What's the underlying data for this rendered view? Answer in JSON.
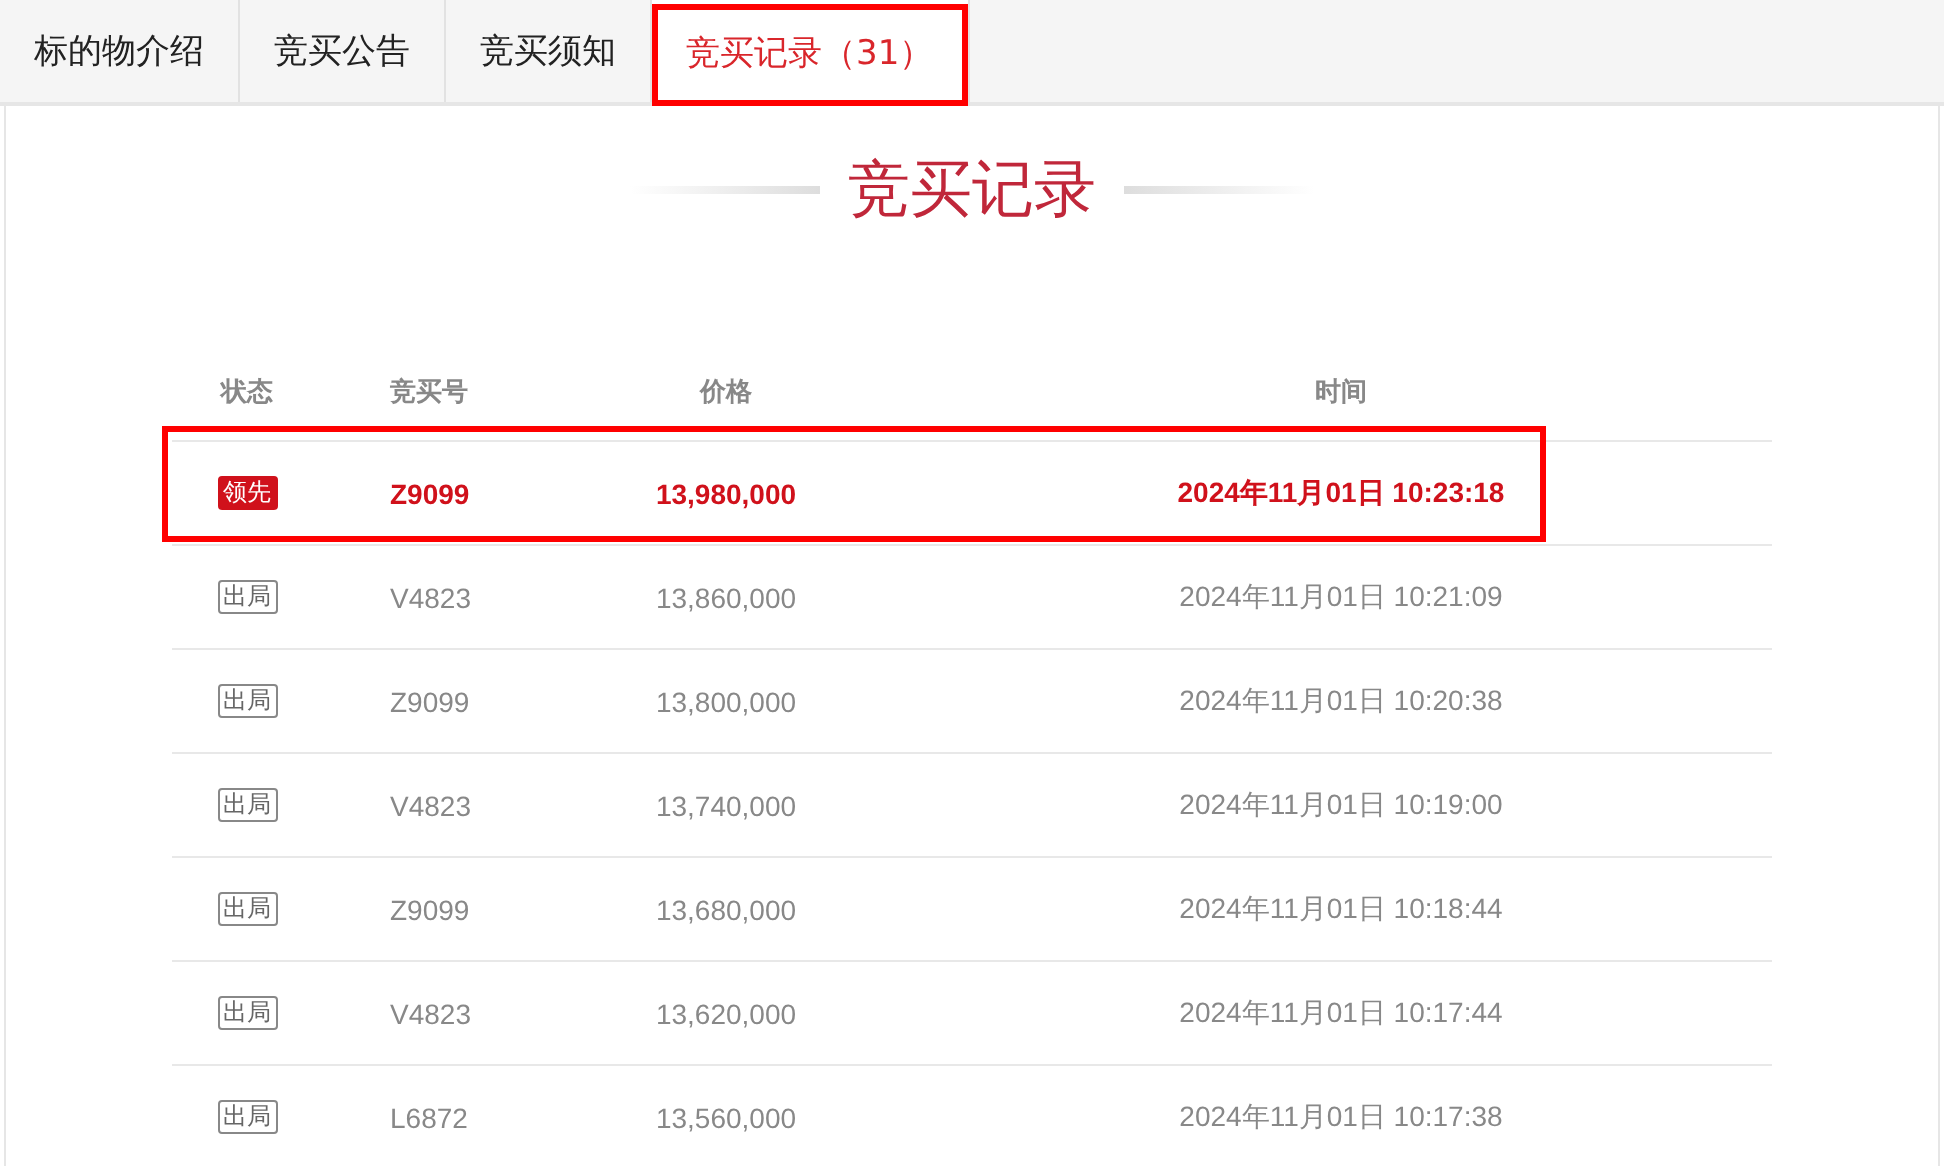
{
  "tabs": [
    {
      "label": "标的物介绍",
      "selected": false,
      "highlighted": false
    },
    {
      "label": "竞买公告",
      "selected": false,
      "highlighted": false
    },
    {
      "label": "竞买须知",
      "selected": false,
      "highlighted": false
    },
    {
      "label": "竞买记录（31）",
      "selected": true,
      "highlighted": true
    }
  ],
  "title": "竞买记录",
  "table": {
    "columns": [
      "状态",
      "竞买号",
      "价格",
      "时间"
    ],
    "rows": [
      {
        "status": "领先",
        "kind": "leading",
        "highlighted": true,
        "bidder": "Z9099",
        "price": "13,980,000",
        "time": "2024年11月01日 10:23:18"
      },
      {
        "status": "出局",
        "kind": "out",
        "highlighted": false,
        "bidder": "V4823",
        "price": "13,860,000",
        "time": "2024年11月01日 10:21:09"
      },
      {
        "status": "出局",
        "kind": "out",
        "highlighted": false,
        "bidder": "Z9099",
        "price": "13,800,000",
        "time": "2024年11月01日 10:20:38"
      },
      {
        "status": "出局",
        "kind": "out",
        "highlighted": false,
        "bidder": "V4823",
        "price": "13,740,000",
        "time": "2024年11月01日 10:19:00"
      },
      {
        "status": "出局",
        "kind": "out",
        "highlighted": false,
        "bidder": "Z9099",
        "price": "13,680,000",
        "time": "2024年11月01日 10:18:44"
      },
      {
        "status": "出局",
        "kind": "out",
        "highlighted": false,
        "bidder": "V4823",
        "price": "13,620,000",
        "time": "2024年11月01日 10:17:44"
      },
      {
        "status": "出局",
        "kind": "out",
        "highlighted": false,
        "bidder": "L6872",
        "price": "13,560,000",
        "time": "2024年11月01日 10:17:38"
      }
    ]
  }
}
